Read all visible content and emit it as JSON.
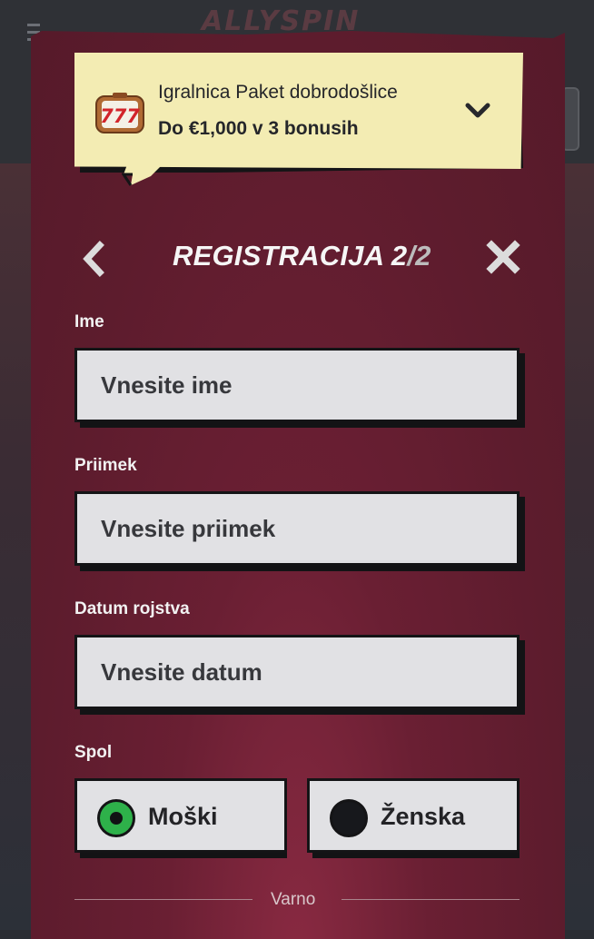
{
  "background": {
    "logo_text": "ALLYSPIN"
  },
  "bonus": {
    "title": "Igralnica Paket dobrodošlice",
    "subtitle": "Do €1,000 v 3 bonusih",
    "icon": "slot-777-icon",
    "expand_icon": "chevron-down-icon"
  },
  "header": {
    "title_main": "REGISTRACIJA 2",
    "title_sep": "/",
    "title_total": "2",
    "back_icon": "chevron-left-icon",
    "close_icon": "close-icon"
  },
  "form": {
    "first_name": {
      "label": "Ime",
      "placeholder": "Vnesite ime",
      "value": ""
    },
    "last_name": {
      "label": "Priimek",
      "placeholder": "Vnesite priimek",
      "value": ""
    },
    "birth_date": {
      "label": "Datum rojstva",
      "placeholder": "Vnesite datum",
      "value": ""
    },
    "gender": {
      "label": "Spol",
      "options": [
        {
          "label": "Moški",
          "selected": true
        },
        {
          "label": "Ženska",
          "selected": false
        }
      ]
    }
  },
  "footer": {
    "secure_label": "Varno"
  },
  "colors": {
    "panel": "#5d1c2d",
    "banner": "#f3ecb3",
    "field_bg": "#e1e1e4",
    "radio_selected": "#2eb14a"
  }
}
